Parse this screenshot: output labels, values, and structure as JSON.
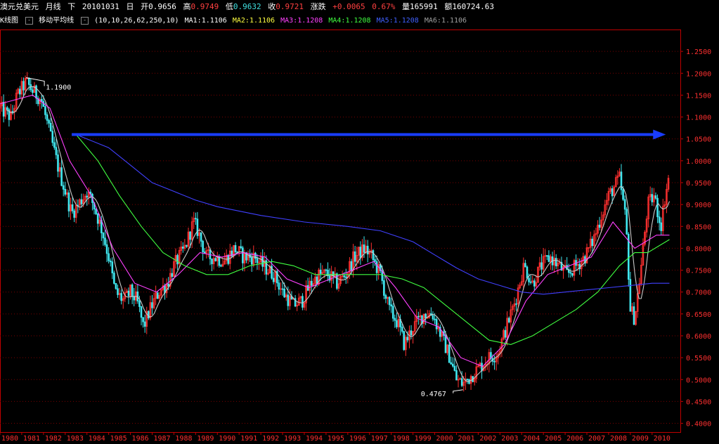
{
  "header": {
    "symbol": "澳元兑美元",
    "period": "月线",
    "direction": "下",
    "date": "20101031",
    "day_label": "日",
    "open_label": "开",
    "open": "0.9656",
    "high_label": "高",
    "high": "0.9749",
    "low_label": "低",
    "low": "0.9632",
    "close_label": "收",
    "close": "0.9721",
    "change_label": "涨跌",
    "change": "+0.0065",
    "change_pct": "0.67%",
    "volume_label": "量",
    "volume": "165991",
    "amount_label": "额",
    "amount": "160724.63"
  },
  "indicator_bar": {
    "tab_kline": "K线图",
    "tab_ma": "移动平均线",
    "params": "(10,10,26,62,250,10)",
    "ma1": "MA1:1.1106",
    "ma2": "MA2:1.1106",
    "ma3": "MA3:1.1208",
    "ma4": "MA4:1.1208",
    "ma5": "MA5:1.1208",
    "ma6": "MA6:1.1106"
  },
  "chart_data": {
    "type": "candlestick",
    "title": "澳元兑美元 月线",
    "ylim": [
      0.38,
      1.3
    ],
    "yticks": [
      "1.2500",
      "1.2000",
      "1.1500",
      "1.1000",
      "1.0500",
      "1.0000",
      "0.9500",
      "0.9000",
      "0.8500",
      "0.8000",
      "0.7500",
      "0.7000",
      "0.6500",
      "0.6000",
      "0.5500",
      "0.5000",
      "0.4500",
      "0.4000"
    ],
    "x_years": [
      "1980",
      "1981",
      "1982",
      "1983",
      "1984",
      "1985",
      "1986",
      "1987",
      "1988",
      "1989",
      "1990",
      "1991",
      "1992",
      "1993",
      "1994",
      "1995",
      "1996",
      "1997",
      "1998",
      "1999",
      "2000",
      "2001",
      "2002",
      "2003",
      "2004",
      "2005",
      "2006",
      "2007",
      "2008",
      "2009",
      "2010"
    ],
    "price_path": [
      [
        1980.0,
        1.12
      ],
      [
        1980.5,
        1.1
      ],
      [
        1980.8,
        1.15
      ],
      [
        1981.2,
        1.18
      ],
      [
        1981.5,
        1.16
      ],
      [
        1981.9,
        1.14
      ],
      [
        1982.3,
        1.06
      ],
      [
        1982.7,
        0.98
      ],
      [
        1983.0,
        0.93
      ],
      [
        1983.3,
        0.88
      ],
      [
        1983.6,
        0.9
      ],
      [
        1984.0,
        0.93
      ],
      [
        1984.3,
        0.9
      ],
      [
        1984.7,
        0.84
      ],
      [
        1985.0,
        0.78
      ],
      [
        1985.3,
        0.7
      ],
      [
        1985.7,
        0.68
      ],
      [
        1986.0,
        0.7
      ],
      [
        1986.3,
        0.68
      ],
      [
        1986.6,
        0.62
      ],
      [
        1986.9,
        0.66
      ],
      [
        1987.3,
        0.7
      ],
      [
        1987.7,
        0.72
      ],
      [
        1988.0,
        0.76
      ],
      [
        1988.5,
        0.8
      ],
      [
        1988.9,
        0.86
      ],
      [
        1989.1,
        0.84
      ],
      [
        1989.5,
        0.78
      ],
      [
        1989.9,
        0.78
      ],
      [
        1990.3,
        0.77
      ],
      [
        1990.8,
        0.8
      ],
      [
        1991.2,
        0.78
      ],
      [
        1991.7,
        0.78
      ],
      [
        1992.1,
        0.76
      ],
      [
        1992.6,
        0.74
      ],
      [
        1993.0,
        0.7
      ],
      [
        1993.5,
        0.67
      ],
      [
        1993.9,
        0.68
      ],
      [
        1994.3,
        0.72
      ],
      [
        1994.7,
        0.74
      ],
      [
        1995.1,
        0.74
      ],
      [
        1995.5,
        0.72
      ],
      [
        1995.9,
        0.74
      ],
      [
        1996.3,
        0.78
      ],
      [
        1996.8,
        0.8
      ],
      [
        1997.1,
        0.78
      ],
      [
        1997.5,
        0.74
      ],
      [
        1997.9,
        0.66
      ],
      [
        1998.3,
        0.63
      ],
      [
        1998.6,
        0.58
      ],
      [
        1999.0,
        0.62
      ],
      [
        1999.5,
        0.65
      ],
      [
        1999.9,
        0.65
      ],
      [
        2000.3,
        0.6
      ],
      [
        2000.7,
        0.55
      ],
      [
        2001.0,
        0.5
      ],
      [
        2001.3,
        0.49
      ],
      [
        2001.7,
        0.51
      ],
      [
        2002.1,
        0.53
      ],
      [
        2002.5,
        0.55
      ],
      [
        2002.9,
        0.56
      ],
      [
        2003.3,
        0.62
      ],
      [
        2003.7,
        0.68
      ],
      [
        2004.1,
        0.76
      ],
      [
        2004.5,
        0.72
      ],
      [
        2004.9,
        0.76
      ],
      [
        2005.3,
        0.78
      ],
      [
        2005.7,
        0.76
      ],
      [
        2006.1,
        0.74
      ],
      [
        2006.5,
        0.76
      ],
      [
        2006.9,
        0.78
      ],
      [
        2007.3,
        0.82
      ],
      [
        2007.7,
        0.88
      ],
      [
        2008.0,
        0.92
      ],
      [
        2008.5,
        0.96
      ],
      [
        2008.8,
        0.86
      ],
      [
        2009.0,
        0.66
      ],
      [
        2009.2,
        0.64
      ],
      [
        2009.5,
        0.76
      ],
      [
        2009.8,
        0.9
      ],
      [
        2010.1,
        0.92
      ],
      [
        2010.4,
        0.85
      ],
      [
        2010.6,
        0.92
      ],
      [
        2010.8,
        0.97
      ]
    ],
    "series": [
      {
        "name": "MA1",
        "color": "#ffffff"
      },
      {
        "name": "MA2",
        "color": "#ffff40"
      },
      {
        "name": "MA3",
        "color": "#ff40ff"
      },
      {
        "name": "MA4",
        "color": "#40ff40"
      },
      {
        "name": "MA5",
        "color": "#4040ff"
      },
      {
        "name": "MA6",
        "color": "#a0a0a0"
      }
    ],
    "ma3_path": [
      [
        1980,
        1.13
      ],
      [
        1981.5,
        1.15
      ],
      [
        1982.3,
        1.12
      ],
      [
        1983.2,
        1.0
      ],
      [
        1984.2,
        0.92
      ],
      [
        1985.2,
        0.8
      ],
      [
        1986.2,
        0.72
      ],
      [
        1987.2,
        0.7
      ],
      [
        1988.2,
        0.74
      ],
      [
        1989.2,
        0.79
      ],
      [
        1990.2,
        0.78
      ],
      [
        1991.2,
        0.79
      ],
      [
        1992.2,
        0.78
      ],
      [
        1993.2,
        0.73
      ],
      [
        1994.2,
        0.71
      ],
      [
        1995.2,
        0.73
      ],
      [
        1996.2,
        0.75
      ],
      [
        1997.2,
        0.77
      ],
      [
        1998.2,
        0.71
      ],
      [
        1999.2,
        0.64
      ],
      [
        2000.2,
        0.62
      ],
      [
        2001.2,
        0.55
      ],
      [
        2002.2,
        0.53
      ],
      [
        2003.2,
        0.58
      ],
      [
        2004.2,
        0.68
      ],
      [
        2005.2,
        0.74
      ],
      [
        2006.2,
        0.76
      ],
      [
        2007.2,
        0.78
      ],
      [
        2008.2,
        0.86
      ],
      [
        2009.2,
        0.8
      ],
      [
        2010.2,
        0.83
      ],
      [
        2010.8,
        0.83
      ]
    ],
    "ma4_path": [
      [
        1983.5,
        1.06
      ],
      [
        1984.5,
        1.0
      ],
      [
        1985.5,
        0.92
      ],
      [
        1986.5,
        0.85
      ],
      [
        1987.5,
        0.79
      ],
      [
        1988.5,
        0.76
      ],
      [
        1989.5,
        0.74
      ],
      [
        1990.5,
        0.74
      ],
      [
        1991.5,
        0.76
      ],
      [
        1992.5,
        0.77
      ],
      [
        1993.5,
        0.76
      ],
      [
        1994.5,
        0.74
      ],
      [
        1995.5,
        0.74
      ],
      [
        1996.5,
        0.74
      ],
      [
        1997.5,
        0.74
      ],
      [
        1998.5,
        0.73
      ],
      [
        1999.5,
        0.71
      ],
      [
        2000.5,
        0.67
      ],
      [
        2001.5,
        0.63
      ],
      [
        2002.5,
        0.59
      ],
      [
        2003.5,
        0.58
      ],
      [
        2004.5,
        0.6
      ],
      [
        2005.5,
        0.63
      ],
      [
        2006.5,
        0.66
      ],
      [
        2007.5,
        0.7
      ],
      [
        2008.5,
        0.76
      ],
      [
        2009.2,
        0.79
      ],
      [
        2009.8,
        0.79
      ],
      [
        2010.8,
        0.82
      ]
    ],
    "ma5_path": [
      [
        1983.5,
        1.06
      ],
      [
        1985,
        1.03
      ],
      [
        1986,
        0.99
      ],
      [
        1987,
        0.95
      ],
      [
        1988,
        0.93
      ],
      [
        1989,
        0.91
      ],
      [
        1990,
        0.895
      ],
      [
        1992,
        0.875
      ],
      [
        1994,
        0.86
      ],
      [
        1996,
        0.85
      ],
      [
        1997.5,
        0.84
      ],
      [
        1999,
        0.815
      ],
      [
        2000,
        0.785
      ],
      [
        2001,
        0.755
      ],
      [
        2002,
        0.73
      ],
      [
        2003,
        0.715
      ],
      [
        2004,
        0.7
      ],
      [
        2005,
        0.695
      ],
      [
        2006,
        0.7
      ],
      [
        2007,
        0.705
      ],
      [
        2008,
        0.71
      ],
      [
        2009,
        0.715
      ],
      [
        2010,
        0.72
      ],
      [
        2010.8,
        0.72
      ]
    ],
    "annotations": [
      {
        "text": "1.1900",
        "value": 1.19,
        "year": 1981.2
      },
      {
        "text": "0.4767",
        "value": 0.4767,
        "year": 2001.3
      }
    ],
    "arrow": {
      "from_year": 1983.3,
      "to_year": 2010.5,
      "value": 1.06
    }
  }
}
